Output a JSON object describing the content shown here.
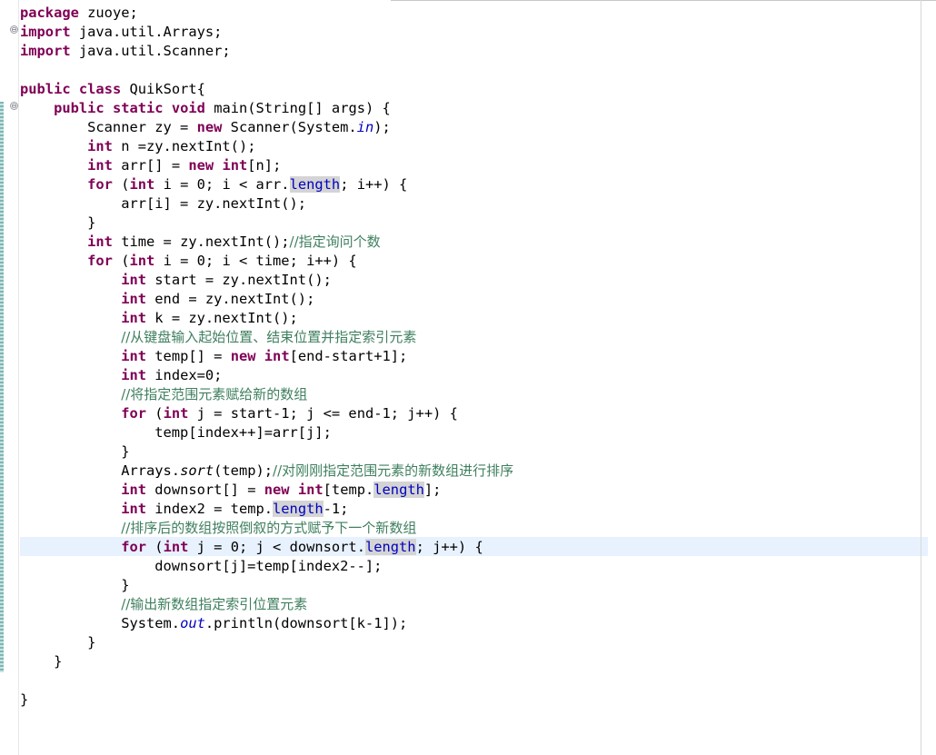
{
  "editor": {
    "lines": [
      [
        {
          "t": "kw",
          "v": "package"
        },
        {
          "t": "p",
          "v": " zuoye;"
        }
      ],
      [
        {
          "t": "kw",
          "v": "import"
        },
        {
          "t": "p",
          "v": " java.util.Arrays;"
        }
      ],
      [
        {
          "t": "kw",
          "v": "import"
        },
        {
          "t": "p",
          "v": " java.util.Scanner;"
        }
      ],
      [],
      [
        {
          "t": "kw",
          "v": "public"
        },
        {
          "t": "p",
          "v": " "
        },
        {
          "t": "kw",
          "v": "class"
        },
        {
          "t": "p",
          "v": " QuikSort{"
        }
      ],
      [
        {
          "t": "p",
          "v": "    "
        },
        {
          "t": "kw",
          "v": "public"
        },
        {
          "t": "p",
          "v": " "
        },
        {
          "t": "kw",
          "v": "static"
        },
        {
          "t": "p",
          "v": " "
        },
        {
          "t": "kw",
          "v": "void"
        },
        {
          "t": "p",
          "v": " main(String[] args) {"
        }
      ],
      [
        {
          "t": "p",
          "v": "        Scanner zy = "
        },
        {
          "t": "kw",
          "v": "new"
        },
        {
          "t": "p",
          "v": " Scanner(System."
        },
        {
          "t": "fld",
          "v": "in"
        },
        {
          "t": "p",
          "v": ");"
        }
      ],
      [
        {
          "t": "p",
          "v": "        "
        },
        {
          "t": "kw",
          "v": "int"
        },
        {
          "t": "p",
          "v": " n =zy.nextInt();"
        }
      ],
      [
        {
          "t": "p",
          "v": "        "
        },
        {
          "t": "kw",
          "v": "int"
        },
        {
          "t": "p",
          "v": " arr[] = "
        },
        {
          "t": "kw",
          "v": "new"
        },
        {
          "t": "p",
          "v": " "
        },
        {
          "t": "kw",
          "v": "int"
        },
        {
          "t": "p",
          "v": "[n];"
        }
      ],
      [
        {
          "t": "p",
          "v": "        "
        },
        {
          "t": "kw",
          "v": "for"
        },
        {
          "t": "p",
          "v": " ("
        },
        {
          "t": "kw",
          "v": "int"
        },
        {
          "t": "p",
          "v": " i = 0; i < arr."
        },
        {
          "t": "occ",
          "v": "length"
        },
        {
          "t": "p",
          "v": "; i++) {"
        }
      ],
      [
        {
          "t": "p",
          "v": "            arr[i] = zy.nextInt();"
        }
      ],
      [
        {
          "t": "p",
          "v": "        }"
        }
      ],
      [
        {
          "t": "p",
          "v": "        "
        },
        {
          "t": "kw",
          "v": "int"
        },
        {
          "t": "p",
          "v": " time = zy.nextInt();"
        },
        {
          "t": "cm",
          "v": "//指定询问个数"
        }
      ],
      [
        {
          "t": "p",
          "v": "        "
        },
        {
          "t": "kw",
          "v": "for"
        },
        {
          "t": "p",
          "v": " ("
        },
        {
          "t": "kw",
          "v": "int"
        },
        {
          "t": "p",
          "v": " i = 0; i < time; i++) {"
        }
      ],
      [
        {
          "t": "p",
          "v": "            "
        },
        {
          "t": "kw",
          "v": "int"
        },
        {
          "t": "p",
          "v": " start = zy.nextInt();"
        }
      ],
      [
        {
          "t": "p",
          "v": "            "
        },
        {
          "t": "kw",
          "v": "int"
        },
        {
          "t": "p",
          "v": " end = zy.nextInt();"
        }
      ],
      [
        {
          "t": "p",
          "v": "            "
        },
        {
          "t": "kw",
          "v": "int"
        },
        {
          "t": "p",
          "v": " k = zy.nextInt();"
        }
      ],
      [
        {
          "t": "p",
          "v": "            "
        },
        {
          "t": "cm",
          "v": "//从键盘输入起始位置、结束位置并指定索引元素"
        }
      ],
      [
        {
          "t": "p",
          "v": "            "
        },
        {
          "t": "kw",
          "v": "int"
        },
        {
          "t": "p",
          "v": " temp[] = "
        },
        {
          "t": "kw",
          "v": "new"
        },
        {
          "t": "p",
          "v": " "
        },
        {
          "t": "kw",
          "v": "int"
        },
        {
          "t": "p",
          "v": "[end-start+1];"
        }
      ],
      [
        {
          "t": "p",
          "v": "            "
        },
        {
          "t": "kw",
          "v": "int"
        },
        {
          "t": "p",
          "v": " index=0;"
        }
      ],
      [
        {
          "t": "p",
          "v": "            "
        },
        {
          "t": "cm",
          "v": "//将指定范围元素赋给新的数组"
        }
      ],
      [
        {
          "t": "p",
          "v": "            "
        },
        {
          "t": "kw",
          "v": "for"
        },
        {
          "t": "p",
          "v": " ("
        },
        {
          "t": "kw",
          "v": "int"
        },
        {
          "t": "p",
          "v": " j = start-1; j <= end-1; j++) {"
        }
      ],
      [
        {
          "t": "p",
          "v": "                temp[index++]=arr[j];"
        }
      ],
      [
        {
          "t": "p",
          "v": "            }"
        }
      ],
      [
        {
          "t": "p",
          "v": "            Arrays."
        },
        {
          "t": "mth",
          "v": "sort"
        },
        {
          "t": "p",
          "v": "(temp);"
        },
        {
          "t": "cm",
          "v": "//对刚刚指定范围元素的新数组进行排序"
        }
      ],
      [
        {
          "t": "p",
          "v": "            "
        },
        {
          "t": "kw",
          "v": "int"
        },
        {
          "t": "p",
          "v": " downsort[] = "
        },
        {
          "t": "kw",
          "v": "new"
        },
        {
          "t": "p",
          "v": " "
        },
        {
          "t": "kw",
          "v": "int"
        },
        {
          "t": "p",
          "v": "[temp."
        },
        {
          "t": "occ",
          "v": "length"
        },
        {
          "t": "p",
          "v": "];"
        }
      ],
      [
        {
          "t": "p",
          "v": "            "
        },
        {
          "t": "kw",
          "v": "int"
        },
        {
          "t": "p",
          "v": " index2 = temp."
        },
        {
          "t": "occ",
          "v": "length"
        },
        {
          "t": "p",
          "v": "-1;"
        }
      ],
      [
        {
          "t": "p",
          "v": "            "
        },
        {
          "t": "cm",
          "v": "//排序后的数组按照倒叙的方式赋予下一个新数组"
        }
      ],
      [
        {
          "t": "p",
          "v": "            "
        },
        {
          "t": "kw",
          "v": "for"
        },
        {
          "t": "p",
          "v": " ("
        },
        {
          "t": "kw",
          "v": "int"
        },
        {
          "t": "p",
          "v": " j = 0; j < downsort."
        },
        {
          "t": "occ",
          "v": "length"
        },
        {
          "t": "p",
          "v": "; j++) {"
        }
      ],
      [
        {
          "t": "p",
          "v": "                downsort[j]=temp[index2--];"
        }
      ],
      [
        {
          "t": "p",
          "v": "            }"
        }
      ],
      [
        {
          "t": "p",
          "v": "            "
        },
        {
          "t": "cm",
          "v": "//输出新数组指定索引位置元素"
        }
      ],
      [
        {
          "t": "p",
          "v": "            System."
        },
        {
          "t": "fld",
          "v": "out"
        },
        {
          "t": "p",
          "v": ".println(downsort[k-1]);"
        }
      ],
      [
        {
          "t": "p",
          "v": "        }"
        }
      ],
      [
        {
          "t": "p",
          "v": "    }"
        }
      ],
      [],
      [
        {
          "t": "p",
          "v": "}"
        }
      ]
    ]
  },
  "gutter": {
    "fold_markers": [
      "⊖",
      "⊖"
    ]
  },
  "colors": {
    "keyword": "#7f0055",
    "comment": "#3f7f5f",
    "field": "#0000c0",
    "current_line": "#e8f2fe",
    "occurrence_highlight": "#d4d4d4"
  }
}
